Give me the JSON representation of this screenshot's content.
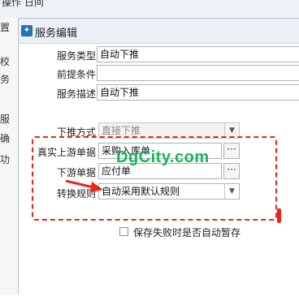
{
  "background": {
    "top_text": "操作 日间",
    "left_chars": [
      "置",
      "校",
      "务",
      "服",
      "确",
      "功"
    ]
  },
  "dialog": {
    "title": "服务编辑",
    "fields": {
      "service_type": {
        "label": "服务类型",
        "value": "自动下推"
      },
      "precondition": {
        "label": "前提条件",
        "value": ""
      },
      "description": {
        "label": "服务描述",
        "value": "自动下推"
      },
      "push_method": {
        "label": "下推方式",
        "value": "直接下推"
      },
      "upstream": {
        "label": "真实上游单据",
        "value": "采购入库单"
      },
      "downstream": {
        "label": "下游单据",
        "value": "应付单"
      },
      "conversion_rule": {
        "label": "转换规则",
        "value": "自动采用默认规则"
      }
    },
    "lookup_button": "···",
    "checkbox_label": "保存失败时是否自动暂存",
    "checkbox_checked": false
  },
  "watermark": "DgCity.com",
  "colors": {
    "annotation": "#e8261c",
    "watermark": "#19b35a",
    "title_icon": "#2a6fb3"
  }
}
